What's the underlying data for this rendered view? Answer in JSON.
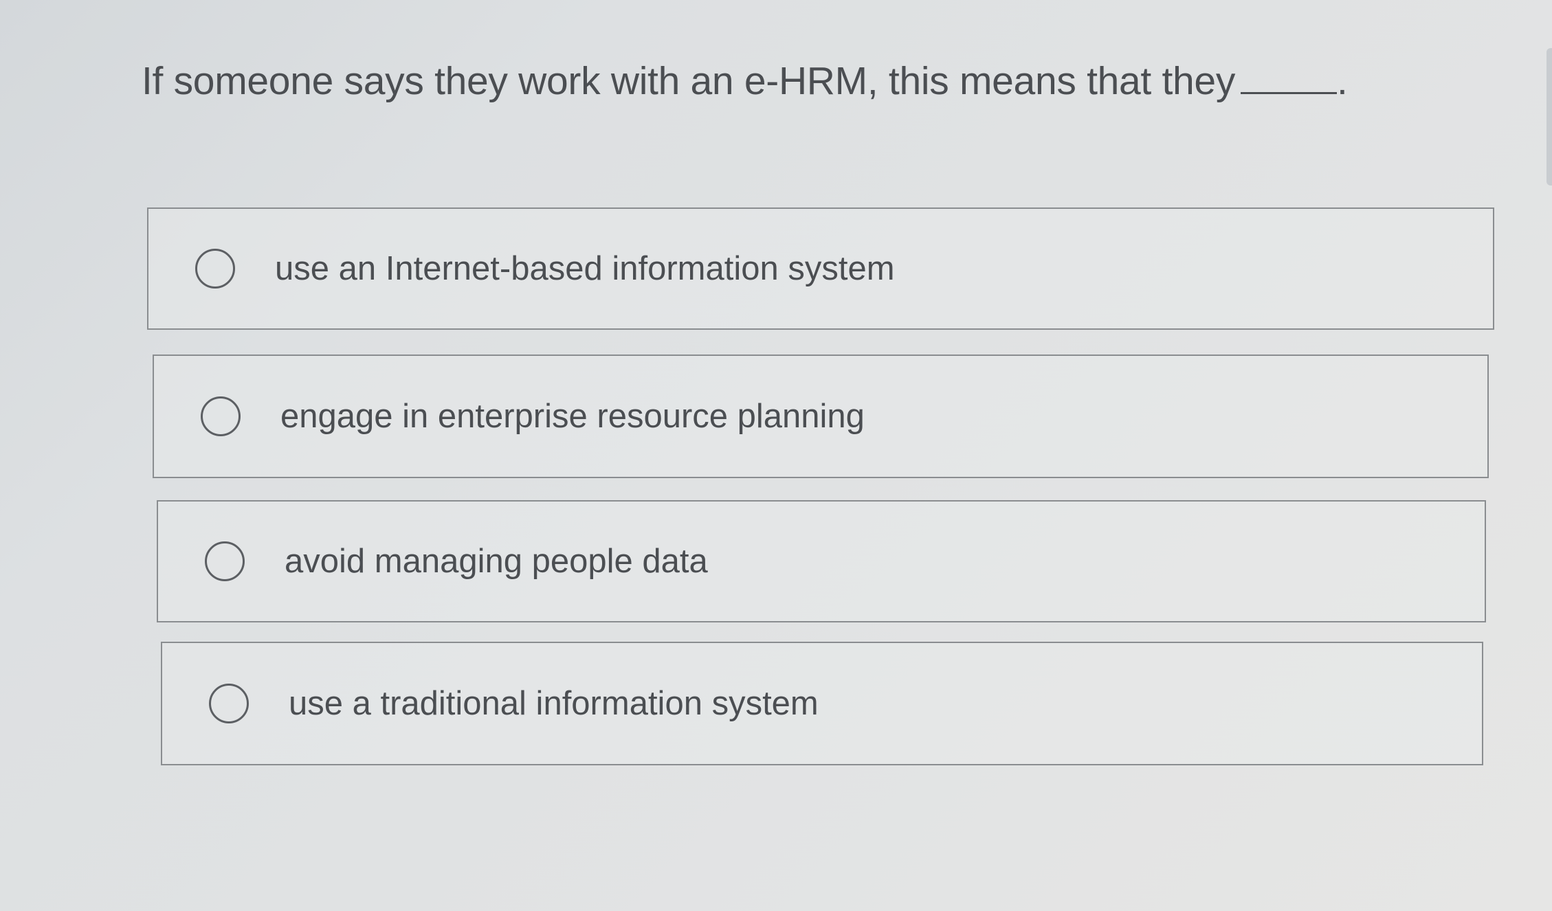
{
  "question": {
    "text": "If someone says they work with an e-HRM, this means that they",
    "suffix": "."
  },
  "options": [
    {
      "label": "use an Internet-based information system",
      "selected": false
    },
    {
      "label": "engage in enterprise resource planning",
      "selected": false
    },
    {
      "label": "avoid managing people data",
      "selected": false
    },
    {
      "label": "use a traditional information system",
      "selected": false
    }
  ],
  "colors": {
    "text": "#4b4e52",
    "border": "#8a8d90",
    "background": "#dfe1e2"
  }
}
